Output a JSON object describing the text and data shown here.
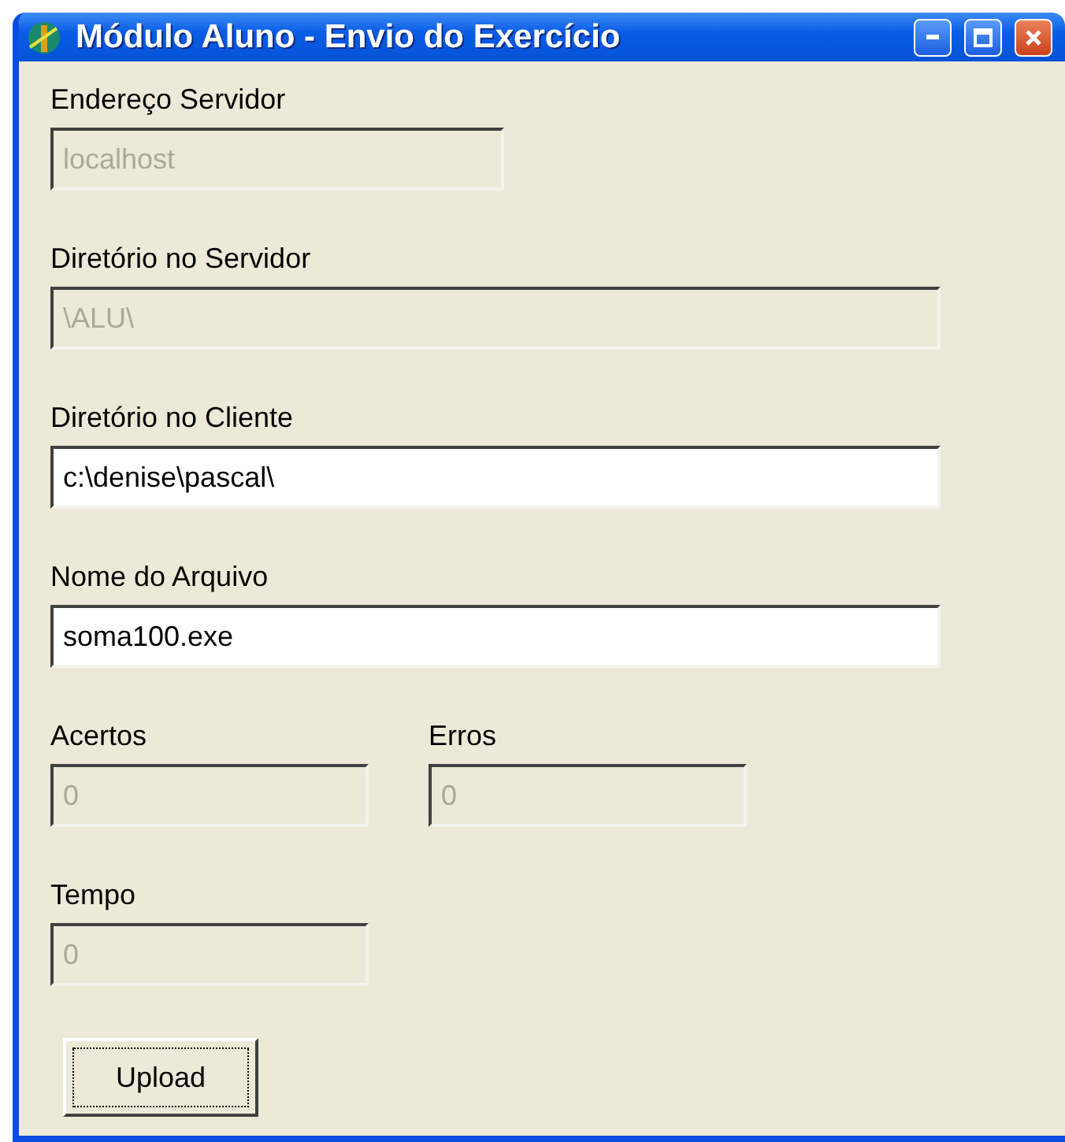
{
  "window": {
    "title": "Módulo Aluno - Envio do Exercício"
  },
  "fields": [
    {
      "label": "Endereço Servidor",
      "value": "localhost",
      "disabled": true
    },
    {
      "label": "Diretório no Servidor",
      "value": "\\ALU\\",
      "disabled": true
    },
    {
      "label": "Diretório no Cliente",
      "value": "c:\\denise\\pascal\\",
      "disabled": false
    },
    {
      "label": "Nome do Arquivo",
      "value": "soma100.exe",
      "disabled": false
    }
  ],
  "scores": [
    {
      "label": "Acertos",
      "value": "0",
      "disabled": true
    },
    {
      "label": "Erros",
      "value": "0",
      "disabled": true
    }
  ],
  "time": {
    "label": "Tempo",
    "value": "0",
    "disabled": true
  },
  "button": {
    "label": "Upload",
    "focused": true
  }
}
